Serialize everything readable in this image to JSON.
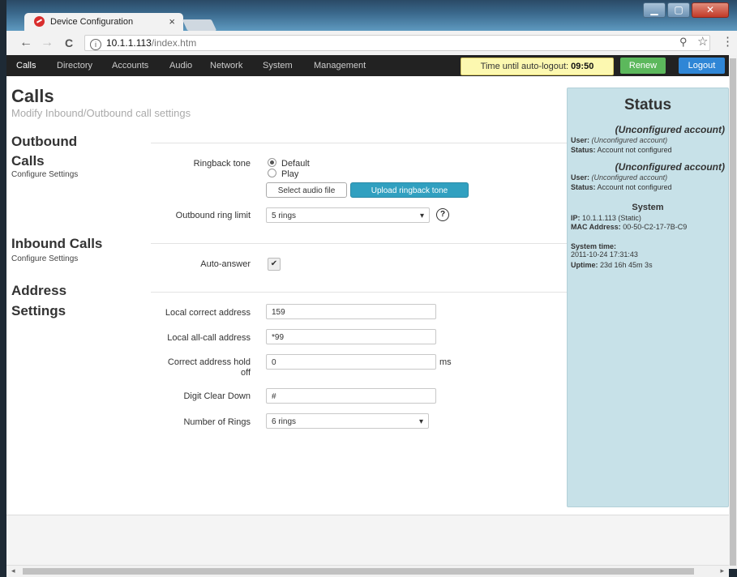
{
  "browser": {
    "tab_title": "Device Configuration",
    "tab_close": "×",
    "url_host": "10.1.1.113",
    "url_path": "/index.htm",
    "back": "←",
    "forward": "→",
    "reload": "C",
    "info": "i",
    "ext1": "⚲",
    "star": "☆",
    "menu": "⋮",
    "min": "▁",
    "max": "▢",
    "close": "✕"
  },
  "nav": {
    "items": [
      "Calls",
      "Directory",
      "Accounts",
      "Audio",
      "Network",
      "System",
      "Management"
    ],
    "timer_label": "Time until auto-logout:",
    "timer_value": "09:50",
    "renew": "Renew",
    "logout": "Logout"
  },
  "page": {
    "title": "Calls",
    "subtitle": "Modify Inbound/Outbound call settings"
  },
  "outbound": {
    "title_line1": "Outbound",
    "title_line2": "Calls",
    "sub": "Configure Settings",
    "ringback_label": "Ringback tone",
    "radio_default": "Default",
    "radio_play": "Play",
    "select_file": "Select audio file",
    "upload": "Upload ringback tone",
    "ring_limit_label": "Outbound ring limit",
    "ring_limit_value": "5 rings",
    "help": "?"
  },
  "inbound": {
    "title": "Inbound Calls",
    "sub": "Configure Settings",
    "auto_answer_label": "Auto-answer",
    "auto_answer_checked": true,
    "check": "✔"
  },
  "address": {
    "title_line1": "Address",
    "title_line2": "Settings",
    "local_correct_label": "Local correct address",
    "local_correct_value": "159",
    "local_allcall_label": "Local all-call address",
    "local_allcall_value": "*99",
    "hold_off_label_1": "Correct address hold",
    "hold_off_label_2": "off",
    "hold_off_value": "0",
    "hold_off_unit": "ms",
    "digit_clear_label": "Digit Clear Down",
    "digit_clear_value": "#",
    "num_rings_label": "Number of Rings",
    "num_rings_value": "6 rings"
  },
  "status": {
    "title": "Status",
    "account1": "(Unconfigured account)",
    "account1_user_label": "User:",
    "account1_user": "(Unconfigured account)",
    "account1_status_label": "Status:",
    "account1_status": "Account not configured",
    "account2": "(Unconfigured account)",
    "account2_user_label": "User:",
    "account2_user": "(Unconfigured account)",
    "account2_status_label": "Status:",
    "account2_status": "Account not configured",
    "system_title": "System",
    "ip_label": "IP:",
    "ip": "10.1.1.113 (Static)",
    "mac_label": "MAC Address:",
    "mac": "00-50-C2-17-7B-C9",
    "time_label": "System time:",
    "time": "2011-10-24 17:31:43",
    "uptime_label": "Uptime:",
    "uptime": "23d 16h 45m 3s"
  }
}
